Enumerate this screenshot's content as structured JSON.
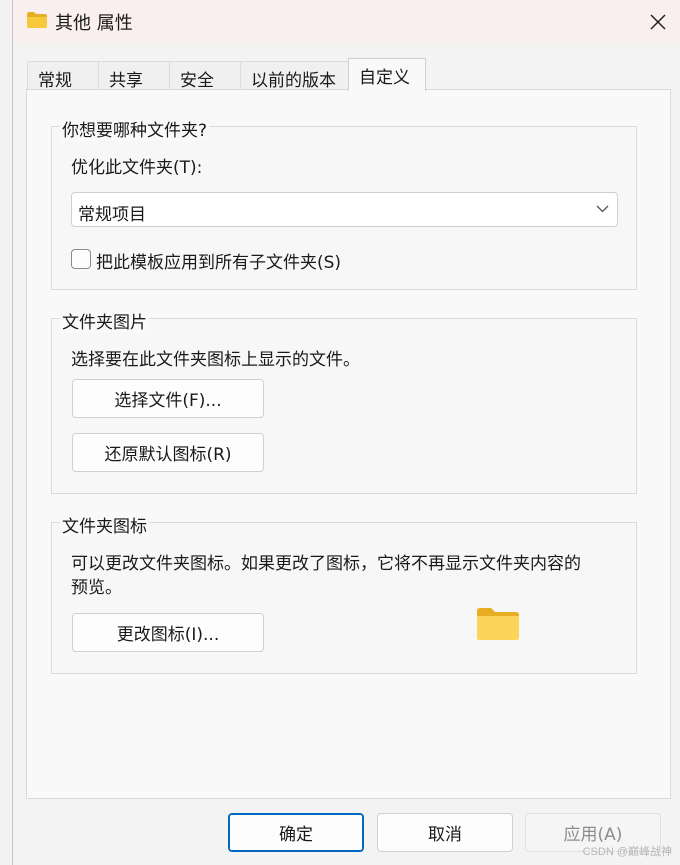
{
  "window": {
    "title": "其他 属性",
    "title_icon": "folder-icon",
    "close_icon": "close-icon"
  },
  "tabs": [
    {
      "label": "常规",
      "active": false
    },
    {
      "label": "共享",
      "active": false
    },
    {
      "label": "安全",
      "active": false
    },
    {
      "label": "以前的版本",
      "active": false
    },
    {
      "label": "自定义",
      "active": true
    }
  ],
  "optimize_group": {
    "title": "你想要哪种文件夹?",
    "optimize_label": "优化此文件夹(T):",
    "select_value": "常规项目",
    "apply_checkbox_label": "把此模板应用到所有子文件夹(S)",
    "apply_checked": false
  },
  "picture_group": {
    "title": "文件夹图片",
    "description": "选择要在此文件夹图标上显示的文件。",
    "choose_file_label": "选择文件(F)...",
    "restore_default_label": "还原默认图标(R)"
  },
  "icon_group": {
    "title": "文件夹图标",
    "description_line1": "可以更改文件夹图标。如果更改了图标，它将不再显示文件夹内容的",
    "description_line2": "预览。",
    "change_icon_label": "更改图标(I)...",
    "preview_icon": "folder-icon"
  },
  "footer": {
    "ok_label": "确定",
    "cancel_label": "取消",
    "apply_label": "应用(A)"
  },
  "watermark": "CSDN @巅峰战神",
  "colors": {
    "accent": "#0067c0",
    "folder": "#f8c93b",
    "titlebar_bg": "#f9efee"
  }
}
